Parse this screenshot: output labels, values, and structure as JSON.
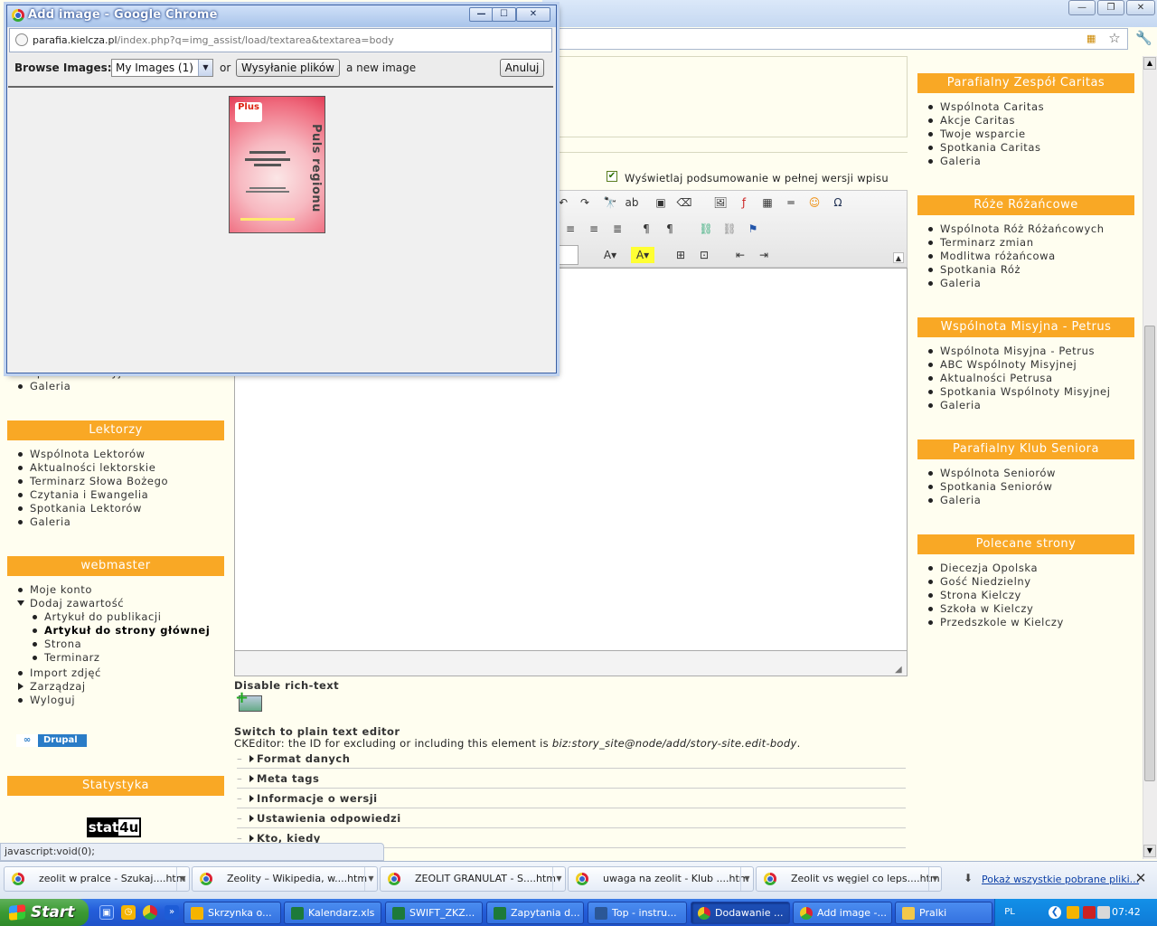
{
  "popup": {
    "title": "Add image - Google Chrome",
    "url_host": "parafia.kielcza.pl",
    "url_path": "/index.php?q=img_assist/load/textarea&textarea=body",
    "browse_label": "Browse Images:",
    "select_value": "My Images (1)",
    "or_label": "or",
    "upload_button": "Wysyłanie plików",
    "new_image_label": "a new image",
    "cancel_button": "Anuluj",
    "thumb_logo": "Plus",
    "thumb_side_text": "Puls regionu"
  },
  "left_sidebar": {
    "partial": [
      "Spotkania Maryjne",
      "Galeria"
    ],
    "lektorzy": {
      "title": "Lektorzy",
      "items": [
        "Wspólnota Lektorów",
        "Aktualności lektorskie",
        "Terminarz Słowa Bożego",
        "Czytania i Ewangelia",
        "Spotkania Lektorów",
        "Galeria"
      ]
    },
    "webmaster": {
      "title": "webmaster",
      "items": [
        "Moje konto",
        "Dodaj zawartość",
        "Artykuł do publikacji",
        "Artykuł do strony głównej",
        "Strona",
        "Terminarz",
        "Import zdjęć",
        "Zarządzaj",
        "Wyloguj"
      ]
    },
    "drupal_badge": "Drupal",
    "statystyka_title": "Statystyka",
    "stat4u_a": "stat",
    "stat4u_b": "4u"
  },
  "right_sidebar": {
    "caritas": {
      "title": "Parafialny Zespół Caritas",
      "items": [
        "Wspólnota Caritas",
        "Akcje Caritas",
        "Twoje wsparcie",
        "Spotkania Caritas",
        "Galeria"
      ]
    },
    "roze": {
      "title": "Róże Różańcowe",
      "items": [
        "Wspólnota Róż Różańcowych",
        "Terminarz zmian",
        "Modlitwa różańcowa",
        "Spotkania Róż",
        "Galeria"
      ]
    },
    "petrus": {
      "title": "Wspólnota Misyjna - Petrus",
      "items": [
        "Wspólnota Misyjna - Petrus",
        "ABC Wspólnoty Misyjnej",
        "Aktualności Petrusa",
        "Spotkania Wspólnoty Misyjnej",
        "Galeria"
      ]
    },
    "seniorzy": {
      "title": "Parafialny Klub Seniora",
      "items": [
        "Wspólnota Seniorów",
        "Spotkania Seniorów",
        "Galeria"
      ]
    },
    "polecane": {
      "title": "Polecane strony",
      "items": [
        "Diecezja Opolska",
        "Gość Niedzielny",
        "Strona Kielczy",
        "Szkoła w Kielczy",
        "Przedszkole w Kielczy"
      ]
    }
  },
  "editor": {
    "summary_checkbox": "Wyświetlaj podsumowanie w pełnej wersji wpisu",
    "disable_rich": "Disable rich-text",
    "switch_plain": "Switch to plain text editor",
    "ck_note_a": "CKEditor: the ID for excluding or including this element is ",
    "ck_note_id": "biz:story_site@node/add/story-site.edit-body",
    "ck_note_b": ".",
    "fieldsets": [
      "Format danych",
      "Meta tags",
      "Informacje o wersji",
      "Ustawienia odpowiedzi",
      "Kto, kiedy"
    ]
  },
  "statusbar": "javascript:void(0);",
  "downloads": {
    "items": [
      "zeolit w pralce - Szukaj....htm",
      "Zeolity – Wikipedia, w....htm",
      "ZEOLIT GRANULAT - S....htm",
      "uwaga na zeolit - Klub ....htm",
      "Zeolit vs węgiel co leps....htm"
    ],
    "show_all": "Pokaż wszystkie pobrane pliki..."
  },
  "taskbar": {
    "start": "Start",
    "tasks": [
      "Skrzynka o...",
      "Kalendarz.xls",
      "SWIFT_ZKZ...",
      "Zapytania d...",
      "Top - instru...",
      "Dodawanie ...",
      "Add image -...",
      "Pralki"
    ],
    "lang": "PL",
    "clock": "07:42"
  }
}
